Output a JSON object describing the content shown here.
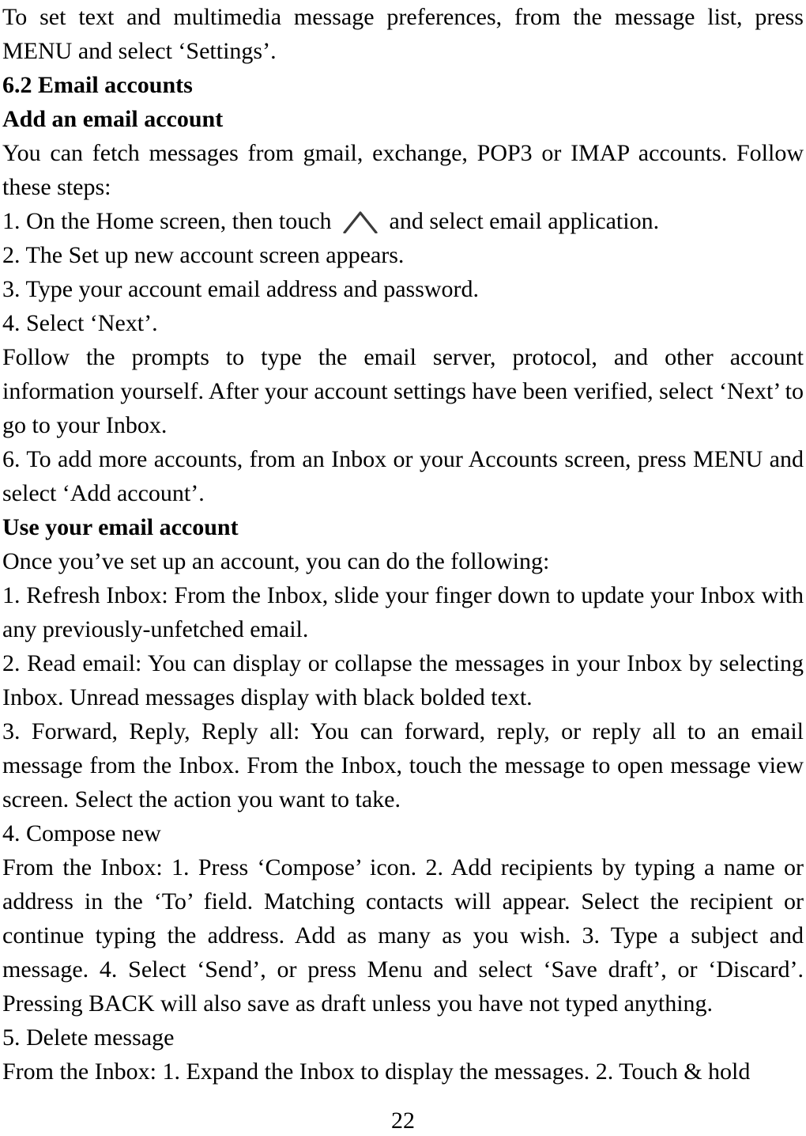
{
  "document": {
    "page_number": "22",
    "blocks": [
      {
        "id": "b0",
        "type": "paragraph",
        "style": "justify",
        "text": "To set text and multimedia message preferences, from the message list, press MENU and select ‘Settings’."
      },
      {
        "id": "b1",
        "type": "heading",
        "level": 2,
        "text": "6.2 Email accounts"
      },
      {
        "id": "b2",
        "type": "heading",
        "level": 3,
        "text": "Add an email account"
      },
      {
        "id": "b3",
        "type": "paragraph",
        "style": "left",
        "text": "You can fetch messages from gmail, exchange, POP3 or IMAP accounts. Follow these steps:"
      },
      {
        "id": "b4",
        "type": "paragraph-with-icon",
        "style": "left",
        "text_before": "1. On the Home screen, then touch",
        "icon": "chevron-up-icon",
        "icon_color": "#3b3b3b",
        "text_after": "and select email application."
      },
      {
        "id": "b5",
        "type": "paragraph",
        "style": "left",
        "text": "2. The Set up new account screen appears."
      },
      {
        "id": "b6",
        "type": "paragraph",
        "style": "left",
        "text": "3. Type your account email address and password."
      },
      {
        "id": "b7",
        "type": "paragraph",
        "style": "left",
        "text": "4. Select ‘Next’."
      },
      {
        "id": "b8",
        "type": "paragraph",
        "style": "justify",
        "text": "Follow the prompts to type the email server, protocol, and other account information yourself. After your account settings have been verified, select ‘Next’ to go to your Inbox."
      },
      {
        "id": "b9",
        "type": "paragraph",
        "style": "justify",
        "text": "6. To add more accounts, from an Inbox or your Accounts screen, press MENU and select ‘Add account’."
      },
      {
        "id": "b10",
        "type": "heading",
        "level": 3,
        "text": "Use your email account"
      },
      {
        "id": "b11",
        "type": "paragraph",
        "style": "left",
        "text": "Once you’ve set up an account, you can do the following:"
      },
      {
        "id": "b12",
        "type": "paragraph",
        "style": "justify",
        "text": "1. Refresh Inbox: From the Inbox, slide your finger down to update your Inbox with any previously-unfetched email."
      },
      {
        "id": "b13",
        "type": "paragraph",
        "style": "justify",
        "text": "2. Read email: You can display or collapse the messages in your Inbox by selecting Inbox. Unread messages display with black bolded text."
      },
      {
        "id": "b14",
        "type": "paragraph",
        "style": "justify",
        "text": "3. Forward, Reply, Reply all: You can forward, reply, or reply all to an email message from the Inbox. From the Inbox, touch the message to open message view screen. Select the action you want to take."
      },
      {
        "id": "b15",
        "type": "paragraph",
        "style": "left",
        "text": "4. Compose new"
      },
      {
        "id": "b16",
        "type": "paragraph",
        "style": "justify",
        "text": "From the Inbox: 1. Press ‘Compose’ icon. 2. Add recipients by typing a name or address in the ‘To’ field. Matching contacts will appear. Select the recipient or continue typing the address. Add as many as you wish. 3. Type a subject and message. 4. Select ‘Send’, or press Menu and select ‘Save draft’, or ‘Discard’. Pressing BACK will also save as draft unless you have not typed anything."
      },
      {
        "id": "b17",
        "type": "paragraph",
        "style": "left",
        "text": "5. Delete message"
      },
      {
        "id": "b18",
        "type": "paragraph",
        "style": "left",
        "text": "From the Inbox: 1. Expand the Inbox to display the messages. 2. Touch & hold"
      }
    ]
  }
}
